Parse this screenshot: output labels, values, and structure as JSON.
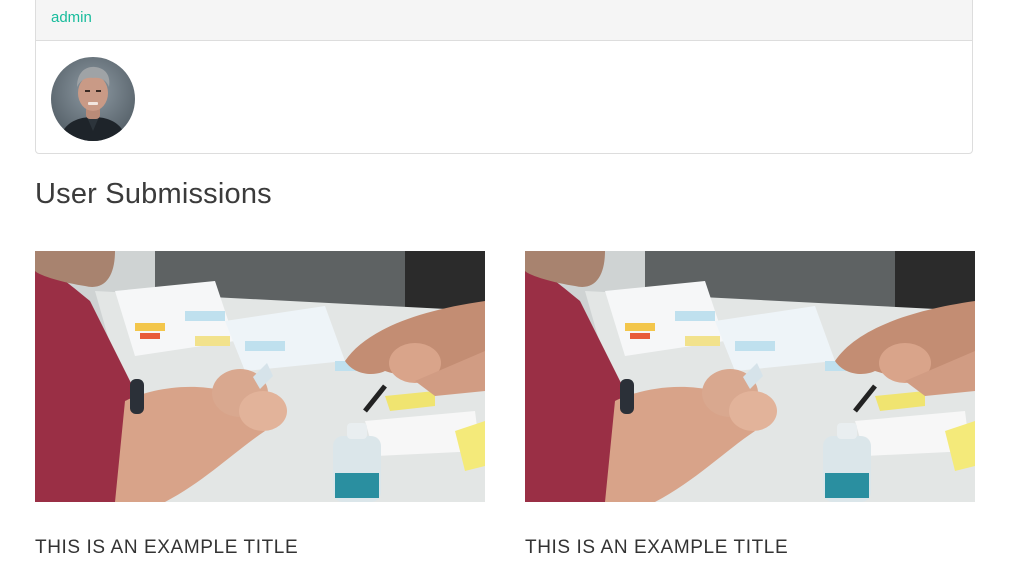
{
  "profile": {
    "username": "admin",
    "avatar_alt": "user avatar"
  },
  "section": {
    "title": "User Submissions"
  },
  "submissions": [
    {
      "title": "THIS IS AN EXAMPLE TITLE",
      "image_alt": "team working with sticky notes"
    },
    {
      "title": "THIS IS AN EXAMPLE TITLE",
      "image_alt": "team working with sticky notes"
    }
  ]
}
